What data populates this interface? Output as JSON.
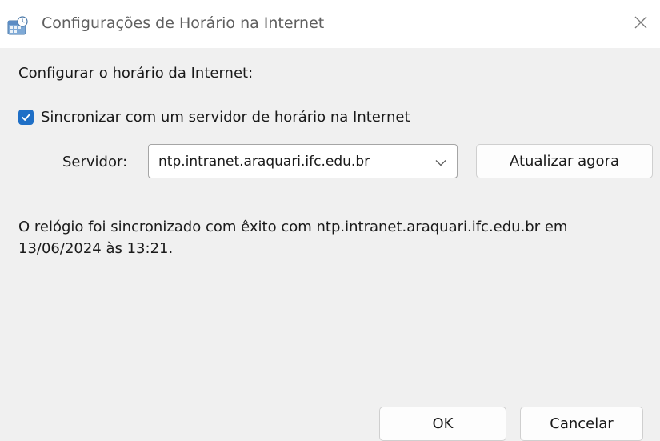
{
  "window": {
    "title": "Configurações de Horário na Internet",
    "icon": "internet-time-settings-icon",
    "close_icon": "close-icon"
  },
  "settings": {
    "section_label": "Configurar o horário da Internet:",
    "sync_checkbox_label": "Sincronizar com um servidor de horário na Internet",
    "sync_checked": true,
    "server_label": "Servidor:",
    "server_value": "ntp.intranet.araquari.ifc.edu.br",
    "update_button": "Atualizar agora"
  },
  "status": {
    "message": "O relógio foi sincronizado com êxito com ntp.intranet.araquari.ifc.edu.br em 13/06/2024 às 13:21."
  },
  "footer": {
    "ok_button": "OK",
    "cancel_button": "Cancelar"
  },
  "colors": {
    "checkbox_accent": "#1f6fc6",
    "title_bar": "#ffffff",
    "dialog_background": "#f0f0f0"
  }
}
